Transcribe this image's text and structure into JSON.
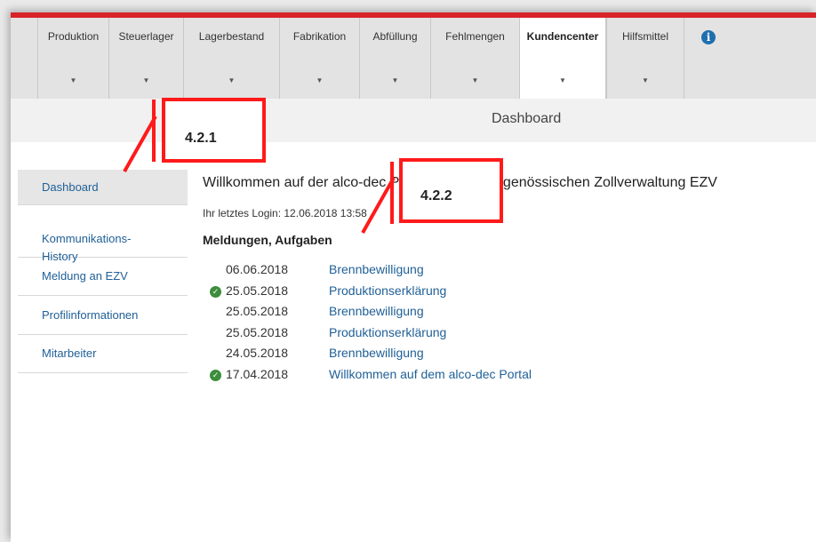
{
  "nav": {
    "items": [
      {
        "label": "Produktion"
      },
      {
        "label": "Steuerlager"
      },
      {
        "label": "Lagerbestand"
      },
      {
        "label": "Fabrikation"
      },
      {
        "label": "Abfüllung"
      },
      {
        "label": "Fehlmengen"
      },
      {
        "label": "Kundencenter",
        "active": true
      },
      {
        "label": "Hilfsmittel"
      }
    ],
    "caret": "▼",
    "info_icon": "info-icon",
    "info_glyph": "i"
  },
  "page": {
    "title": "Dashboard"
  },
  "sidebar": {
    "items": [
      {
        "label": "Dashboard",
        "active": true
      },
      {
        "label": "Kommunikations-\nHistory"
      },
      {
        "label": "Meldung an EZV"
      },
      {
        "label": "Profilinformationen"
      },
      {
        "label": "Mitarbeiter"
      }
    ]
  },
  "main": {
    "welcome": "Willkommen auf der alco-dec Portal von der Eidgenössischen Zollverwaltung EZV",
    "last_login": "Ihr letztes Login: 12.06.2018 13:58",
    "tasks_title": "Meldungen, Aufgaben",
    "tasks": [
      {
        "date": "06.06.2018",
        "label": "Brennbewilligung",
        "done": false
      },
      {
        "date": "25.05.2018",
        "label": "Produktionserklärung",
        "done": true
      },
      {
        "date": "25.05.2018",
        "label": "Brennbewilligung",
        "done": false
      },
      {
        "date": "25.05.2018",
        "label": "Produktionserklärung",
        "done": false
      },
      {
        "date": "24.05.2018",
        "label": "Brennbewilligung",
        "done": false
      },
      {
        "date": "17.04.2018",
        "label": "Willkommen auf dem alco-dec Portal",
        "done": true
      }
    ],
    "check_glyph": "✓"
  },
  "annotations": {
    "a1": "4.2.1",
    "a2": "4.2.2",
    "color": "#ff1a1a"
  },
  "colors": {
    "accent_red": "#d8232a",
    "link_blue": "#1f5f96",
    "check_green": "#3c8d3c"
  }
}
